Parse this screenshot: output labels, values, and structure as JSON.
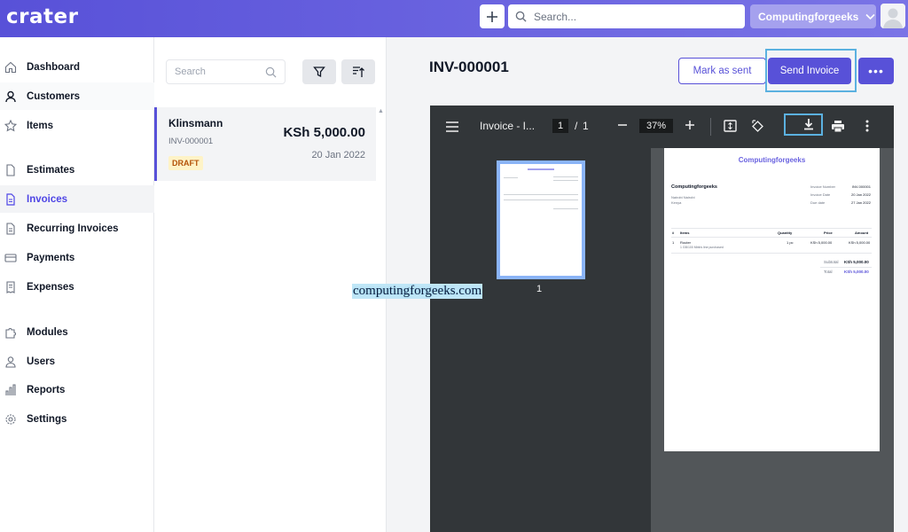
{
  "app": {
    "logo": "crater"
  },
  "header": {
    "search_placeholder": "Search...",
    "company_name": "Computingforgeeks",
    "accent": "#5851d8"
  },
  "sidebar": {
    "items": [
      {
        "label": "Dashboard",
        "icon": "home-icon"
      },
      {
        "label": "Customers",
        "icon": "user-icon"
      },
      {
        "label": "Items",
        "icon": "star-icon"
      },
      {
        "label": "Estimates",
        "icon": "document-icon"
      },
      {
        "label": "Invoices",
        "icon": "invoice-icon",
        "active": true
      },
      {
        "label": "Recurring Invoices",
        "icon": "recurring-icon"
      },
      {
        "label": "Payments",
        "icon": "credit-card-icon"
      },
      {
        "label": "Expenses",
        "icon": "receipt-icon"
      },
      {
        "label": "Modules",
        "icon": "puzzle-icon"
      },
      {
        "label": "Users",
        "icon": "users-icon"
      },
      {
        "label": "Reports",
        "icon": "chart-icon"
      },
      {
        "label": "Settings",
        "icon": "gear-icon"
      }
    ]
  },
  "list": {
    "search_placeholder": "Search",
    "invoices": [
      {
        "customer": "Klinsmann",
        "number": "INV-000001",
        "amount": "KSh 5,000.00",
        "date": "20 Jan 2022",
        "status": "DRAFT"
      }
    ]
  },
  "main": {
    "title": "INV-000001",
    "mark_as_sent": "Mark as sent",
    "send_invoice": "Send Invoice",
    "more": "•••"
  },
  "viewer": {
    "title": "Invoice - I...",
    "page_current": "1",
    "page_sep": "/",
    "page_total": "1",
    "zoom": "37%",
    "thumb_label": "1",
    "document": {
      "header": "Computingforgeeks",
      "company": "Computingforgeeks",
      "address_lines": [
        "Nairobi Nairobi",
        "Kenya"
      ],
      "meta_labels": [
        "Invoice Number",
        "Invoice Date",
        "Due date"
      ],
      "meta_values": [
        "INV-000001",
        "20 Jan 2022",
        "27 Jan 2022"
      ],
      "columns": [
        "#",
        "Items",
        "Quantity",
        "Price",
        "Amount"
      ],
      "row": {
        "no": "1",
        "item": "Router",
        "desc": "1 GB/100 Mbit/s line purchased",
        "qty": "1 pc",
        "price": "KSh 5,000.00",
        "amount": "KSh 5,000.00"
      },
      "subtotal_label": "Subtotal",
      "subtotal_value": "KSh 5,000.00",
      "total_label": "Total",
      "total_value": "KSh 5,000.00"
    }
  },
  "watermark": "computingforgeeks.com"
}
